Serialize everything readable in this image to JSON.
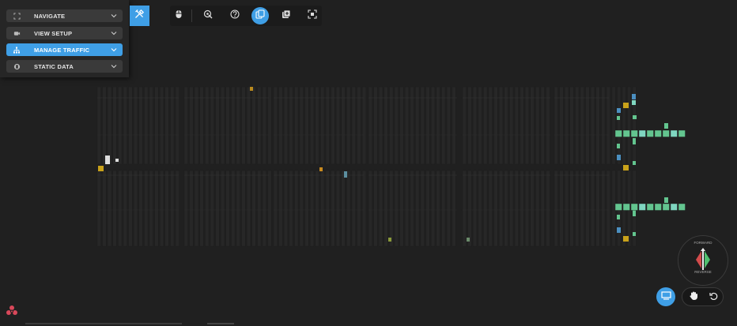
{
  "menu": {
    "items": [
      {
        "label": "NAVIGATE",
        "icon": "expand-icon",
        "active": false
      },
      {
        "label": "VIEW SETUP",
        "icon": "camera-icon",
        "active": false
      },
      {
        "label": "MANAGE TRAFFIC",
        "icon": "network-icon",
        "active": true
      },
      {
        "label": "STATIC DATA",
        "icon": "database-icon",
        "active": false
      }
    ]
  },
  "toolbar": {
    "tools_icon": "tools-icon",
    "buttons": [
      {
        "icon": "mouse-icon",
        "active": false
      },
      {
        "icon": "target-cursor-icon",
        "active": false
      },
      {
        "icon": "help-icon",
        "active": false
      },
      {
        "icon": "copy-layers-icon",
        "active": true
      },
      {
        "icon": "add-box-icon",
        "active": false
      },
      {
        "icon": "fit-view-icon",
        "active": false
      }
    ]
  },
  "compass": {
    "forward_label": "FORWARD",
    "reverse_label": "REVERSE"
  },
  "view_controls": {
    "screen_icon": "monitor-icon",
    "hand_icon": "hand-icon",
    "reset_icon": "reset-icon"
  },
  "colors": {
    "accent": "#3f9fe6",
    "background": "#202020",
    "panel": "#262626",
    "green_tile": "#63c58f",
    "teal_tile": "#7fd6c0",
    "yellow_tile": "#c9a21a",
    "blue_tile": "#4b8fc0"
  }
}
